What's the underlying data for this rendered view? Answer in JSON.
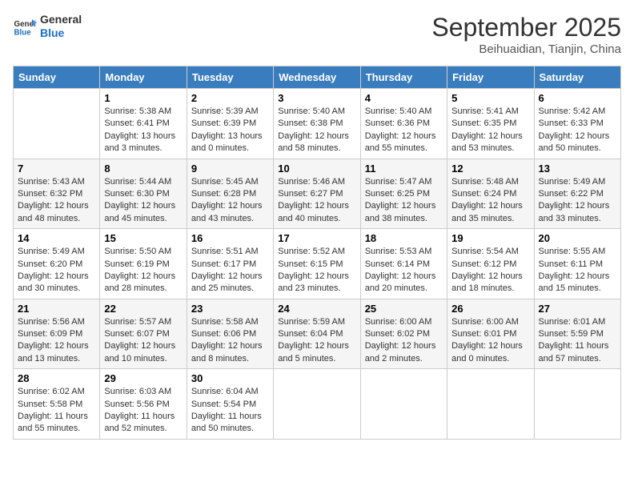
{
  "logo": {
    "general": "General",
    "blue": "Blue"
  },
  "header": {
    "month": "September 2025",
    "location": "Beihuaidian, Tianjin, China"
  },
  "days_of_week": [
    "Sunday",
    "Monday",
    "Tuesday",
    "Wednesday",
    "Thursday",
    "Friday",
    "Saturday"
  ],
  "weeks": [
    [
      {
        "day": "",
        "info": ""
      },
      {
        "day": "1",
        "info": "Sunrise: 5:38 AM\nSunset: 6:41 PM\nDaylight: 13 hours\nand 3 minutes."
      },
      {
        "day": "2",
        "info": "Sunrise: 5:39 AM\nSunset: 6:39 PM\nDaylight: 13 hours\nand 0 minutes."
      },
      {
        "day": "3",
        "info": "Sunrise: 5:40 AM\nSunset: 6:38 PM\nDaylight: 12 hours\nand 58 minutes."
      },
      {
        "day": "4",
        "info": "Sunrise: 5:40 AM\nSunset: 6:36 PM\nDaylight: 12 hours\nand 55 minutes."
      },
      {
        "day": "5",
        "info": "Sunrise: 5:41 AM\nSunset: 6:35 PM\nDaylight: 12 hours\nand 53 minutes."
      },
      {
        "day": "6",
        "info": "Sunrise: 5:42 AM\nSunset: 6:33 PM\nDaylight: 12 hours\nand 50 minutes."
      }
    ],
    [
      {
        "day": "7",
        "info": "Sunrise: 5:43 AM\nSunset: 6:32 PM\nDaylight: 12 hours\nand 48 minutes."
      },
      {
        "day": "8",
        "info": "Sunrise: 5:44 AM\nSunset: 6:30 PM\nDaylight: 12 hours\nand 45 minutes."
      },
      {
        "day": "9",
        "info": "Sunrise: 5:45 AM\nSunset: 6:28 PM\nDaylight: 12 hours\nand 43 minutes."
      },
      {
        "day": "10",
        "info": "Sunrise: 5:46 AM\nSunset: 6:27 PM\nDaylight: 12 hours\nand 40 minutes."
      },
      {
        "day": "11",
        "info": "Sunrise: 5:47 AM\nSunset: 6:25 PM\nDaylight: 12 hours\nand 38 minutes."
      },
      {
        "day": "12",
        "info": "Sunrise: 5:48 AM\nSunset: 6:24 PM\nDaylight: 12 hours\nand 35 minutes."
      },
      {
        "day": "13",
        "info": "Sunrise: 5:49 AM\nSunset: 6:22 PM\nDaylight: 12 hours\nand 33 minutes."
      }
    ],
    [
      {
        "day": "14",
        "info": "Sunrise: 5:49 AM\nSunset: 6:20 PM\nDaylight: 12 hours\nand 30 minutes."
      },
      {
        "day": "15",
        "info": "Sunrise: 5:50 AM\nSunset: 6:19 PM\nDaylight: 12 hours\nand 28 minutes."
      },
      {
        "day": "16",
        "info": "Sunrise: 5:51 AM\nSunset: 6:17 PM\nDaylight: 12 hours\nand 25 minutes."
      },
      {
        "day": "17",
        "info": "Sunrise: 5:52 AM\nSunset: 6:15 PM\nDaylight: 12 hours\nand 23 minutes."
      },
      {
        "day": "18",
        "info": "Sunrise: 5:53 AM\nSunset: 6:14 PM\nDaylight: 12 hours\nand 20 minutes."
      },
      {
        "day": "19",
        "info": "Sunrise: 5:54 AM\nSunset: 6:12 PM\nDaylight: 12 hours\nand 18 minutes."
      },
      {
        "day": "20",
        "info": "Sunrise: 5:55 AM\nSunset: 6:11 PM\nDaylight: 12 hours\nand 15 minutes."
      }
    ],
    [
      {
        "day": "21",
        "info": "Sunrise: 5:56 AM\nSunset: 6:09 PM\nDaylight: 12 hours\nand 13 minutes."
      },
      {
        "day": "22",
        "info": "Sunrise: 5:57 AM\nSunset: 6:07 PM\nDaylight: 12 hours\nand 10 minutes."
      },
      {
        "day": "23",
        "info": "Sunrise: 5:58 AM\nSunset: 6:06 PM\nDaylight: 12 hours\nand 8 minutes."
      },
      {
        "day": "24",
        "info": "Sunrise: 5:59 AM\nSunset: 6:04 PM\nDaylight: 12 hours\nand 5 minutes."
      },
      {
        "day": "25",
        "info": "Sunrise: 6:00 AM\nSunset: 6:02 PM\nDaylight: 12 hours\nand 2 minutes."
      },
      {
        "day": "26",
        "info": "Sunrise: 6:00 AM\nSunset: 6:01 PM\nDaylight: 12 hours\nand 0 minutes."
      },
      {
        "day": "27",
        "info": "Sunrise: 6:01 AM\nSunset: 5:59 PM\nDaylight: 11 hours\nand 57 minutes."
      }
    ],
    [
      {
        "day": "28",
        "info": "Sunrise: 6:02 AM\nSunset: 5:58 PM\nDaylight: 11 hours\nand 55 minutes."
      },
      {
        "day": "29",
        "info": "Sunrise: 6:03 AM\nSunset: 5:56 PM\nDaylight: 11 hours\nand 52 minutes."
      },
      {
        "day": "30",
        "info": "Sunrise: 6:04 AM\nSunset: 5:54 PM\nDaylight: 11 hours\nand 50 minutes."
      },
      {
        "day": "",
        "info": ""
      },
      {
        "day": "",
        "info": ""
      },
      {
        "day": "",
        "info": ""
      },
      {
        "day": "",
        "info": ""
      }
    ]
  ]
}
